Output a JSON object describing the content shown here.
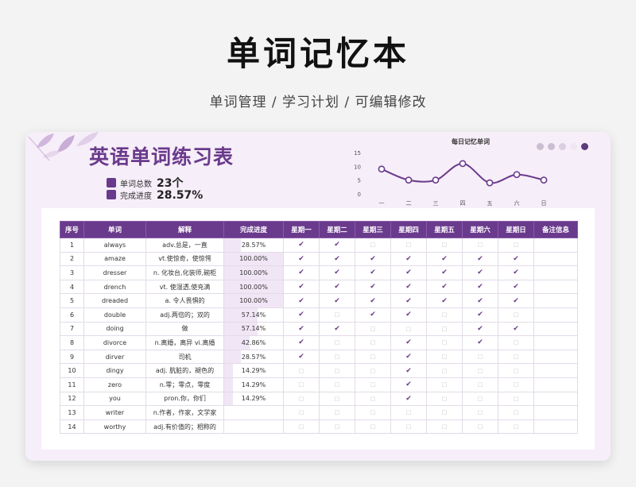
{
  "header": {
    "title": "单词记忆本",
    "subtitle": "单词管理  /  学习计划  /  可编辑修改"
  },
  "sheet": {
    "title": "英语单词练习表",
    "total_label": "单词总数",
    "total_value": "23个",
    "progress_label": "完成进度",
    "progress_value": "28.57%"
  },
  "colors": {
    "accent": "#6a3a8c",
    "card_bg": "#f6eef8",
    "dots": [
      "#c9bfd1",
      "#c9bfd1",
      "#d9cfe1",
      "#eee6f2",
      "#5b3b7a"
    ]
  },
  "chart_data": {
    "type": "line",
    "title": "每日记忆单词",
    "categories": [
      "一",
      "二",
      "三",
      "四",
      "五",
      "六",
      "日"
    ],
    "values": [
      9,
      5,
      5,
      11,
      4,
      7,
      5
    ],
    "y_ticks": [
      "0",
      "5",
      "10",
      "15"
    ],
    "ylim": [
      0,
      15
    ],
    "grid": false
  },
  "table": {
    "columns": [
      "序号",
      "单词",
      "解释",
      "完成进度",
      "星期一",
      "星期二",
      "星期三",
      "星期四",
      "星期五",
      "星期六",
      "星期日",
      "备注信息"
    ],
    "check_on": "✔",
    "check_off": "□",
    "rows": [
      {
        "no": "1",
        "word": "always",
        "meaning": "adv.总是，一直",
        "progress": "28.57%",
        "pct": 0.2857,
        "days": [
          1,
          1,
          0,
          0,
          0,
          0,
          0
        ]
      },
      {
        "no": "2",
        "word": "amaze",
        "meaning": "vt.使惊奇，使惊愕",
        "progress": "100.00%",
        "pct": 1.0,
        "days": [
          1,
          1,
          1,
          1,
          1,
          1,
          1
        ]
      },
      {
        "no": "3",
        "word": "dresser",
        "meaning": "n. 化妆台,化装师,碗柜",
        "progress": "100.00%",
        "pct": 1.0,
        "days": [
          1,
          1,
          1,
          1,
          1,
          1,
          1
        ]
      },
      {
        "no": "4",
        "word": "drench",
        "meaning": "vt. 使湿透,使充满",
        "progress": "100.00%",
        "pct": 1.0,
        "days": [
          1,
          1,
          1,
          1,
          1,
          1,
          1
        ]
      },
      {
        "no": "5",
        "word": "dreaded",
        "meaning": "a. 令人畏惧的",
        "progress": "100.00%",
        "pct": 1.0,
        "days": [
          1,
          1,
          1,
          1,
          1,
          1,
          1
        ]
      },
      {
        "no": "6",
        "word": "double",
        "meaning": "adj.两倍的；双的",
        "progress": "57.14%",
        "pct": 0.5714,
        "days": [
          1,
          0,
          1,
          1,
          0,
          1,
          0
        ]
      },
      {
        "no": "7",
        "word": "doing",
        "meaning": "做",
        "progress": "57.14%",
        "pct": 0.5714,
        "days": [
          1,
          1,
          0,
          0,
          0,
          1,
          1
        ]
      },
      {
        "no": "8",
        "word": "divorce",
        "meaning": "n.离婚，离异 vi.离婚",
        "progress": "42.86%",
        "pct": 0.4286,
        "days": [
          1,
          0,
          0,
          1,
          0,
          1,
          0
        ]
      },
      {
        "no": "9",
        "word": "dirver",
        "meaning": "司机",
        "progress": "28.57%",
        "pct": 0.2857,
        "days": [
          1,
          0,
          0,
          1,
          0,
          0,
          0
        ]
      },
      {
        "no": "10",
        "word": "dingy",
        "meaning": "adj. 肮脏的，褪色的",
        "progress": "14.29%",
        "pct": 0.1429,
        "days": [
          0,
          0,
          0,
          1,
          0,
          0,
          0
        ]
      },
      {
        "no": "11",
        "word": "zero",
        "meaning": "n.零；零点，零度",
        "progress": "14.29%",
        "pct": 0.1429,
        "days": [
          0,
          0,
          0,
          1,
          0,
          0,
          0
        ]
      },
      {
        "no": "12",
        "word": "you",
        "meaning": "pron.你，你们",
        "progress": "14.29%",
        "pct": 0.1429,
        "days": [
          0,
          0,
          0,
          1,
          0,
          0,
          0
        ]
      },
      {
        "no": "13",
        "word": "writer",
        "meaning": "n.作者，作家，文学家",
        "progress": "",
        "pct": 0,
        "days": [
          0,
          0,
          0,
          0,
          0,
          0,
          0
        ]
      },
      {
        "no": "14",
        "word": "worthy",
        "meaning": "adj.有价值的；相称的",
        "progress": "",
        "pct": 0,
        "days": [
          0,
          0,
          0,
          0,
          0,
          0,
          0
        ]
      }
    ]
  }
}
